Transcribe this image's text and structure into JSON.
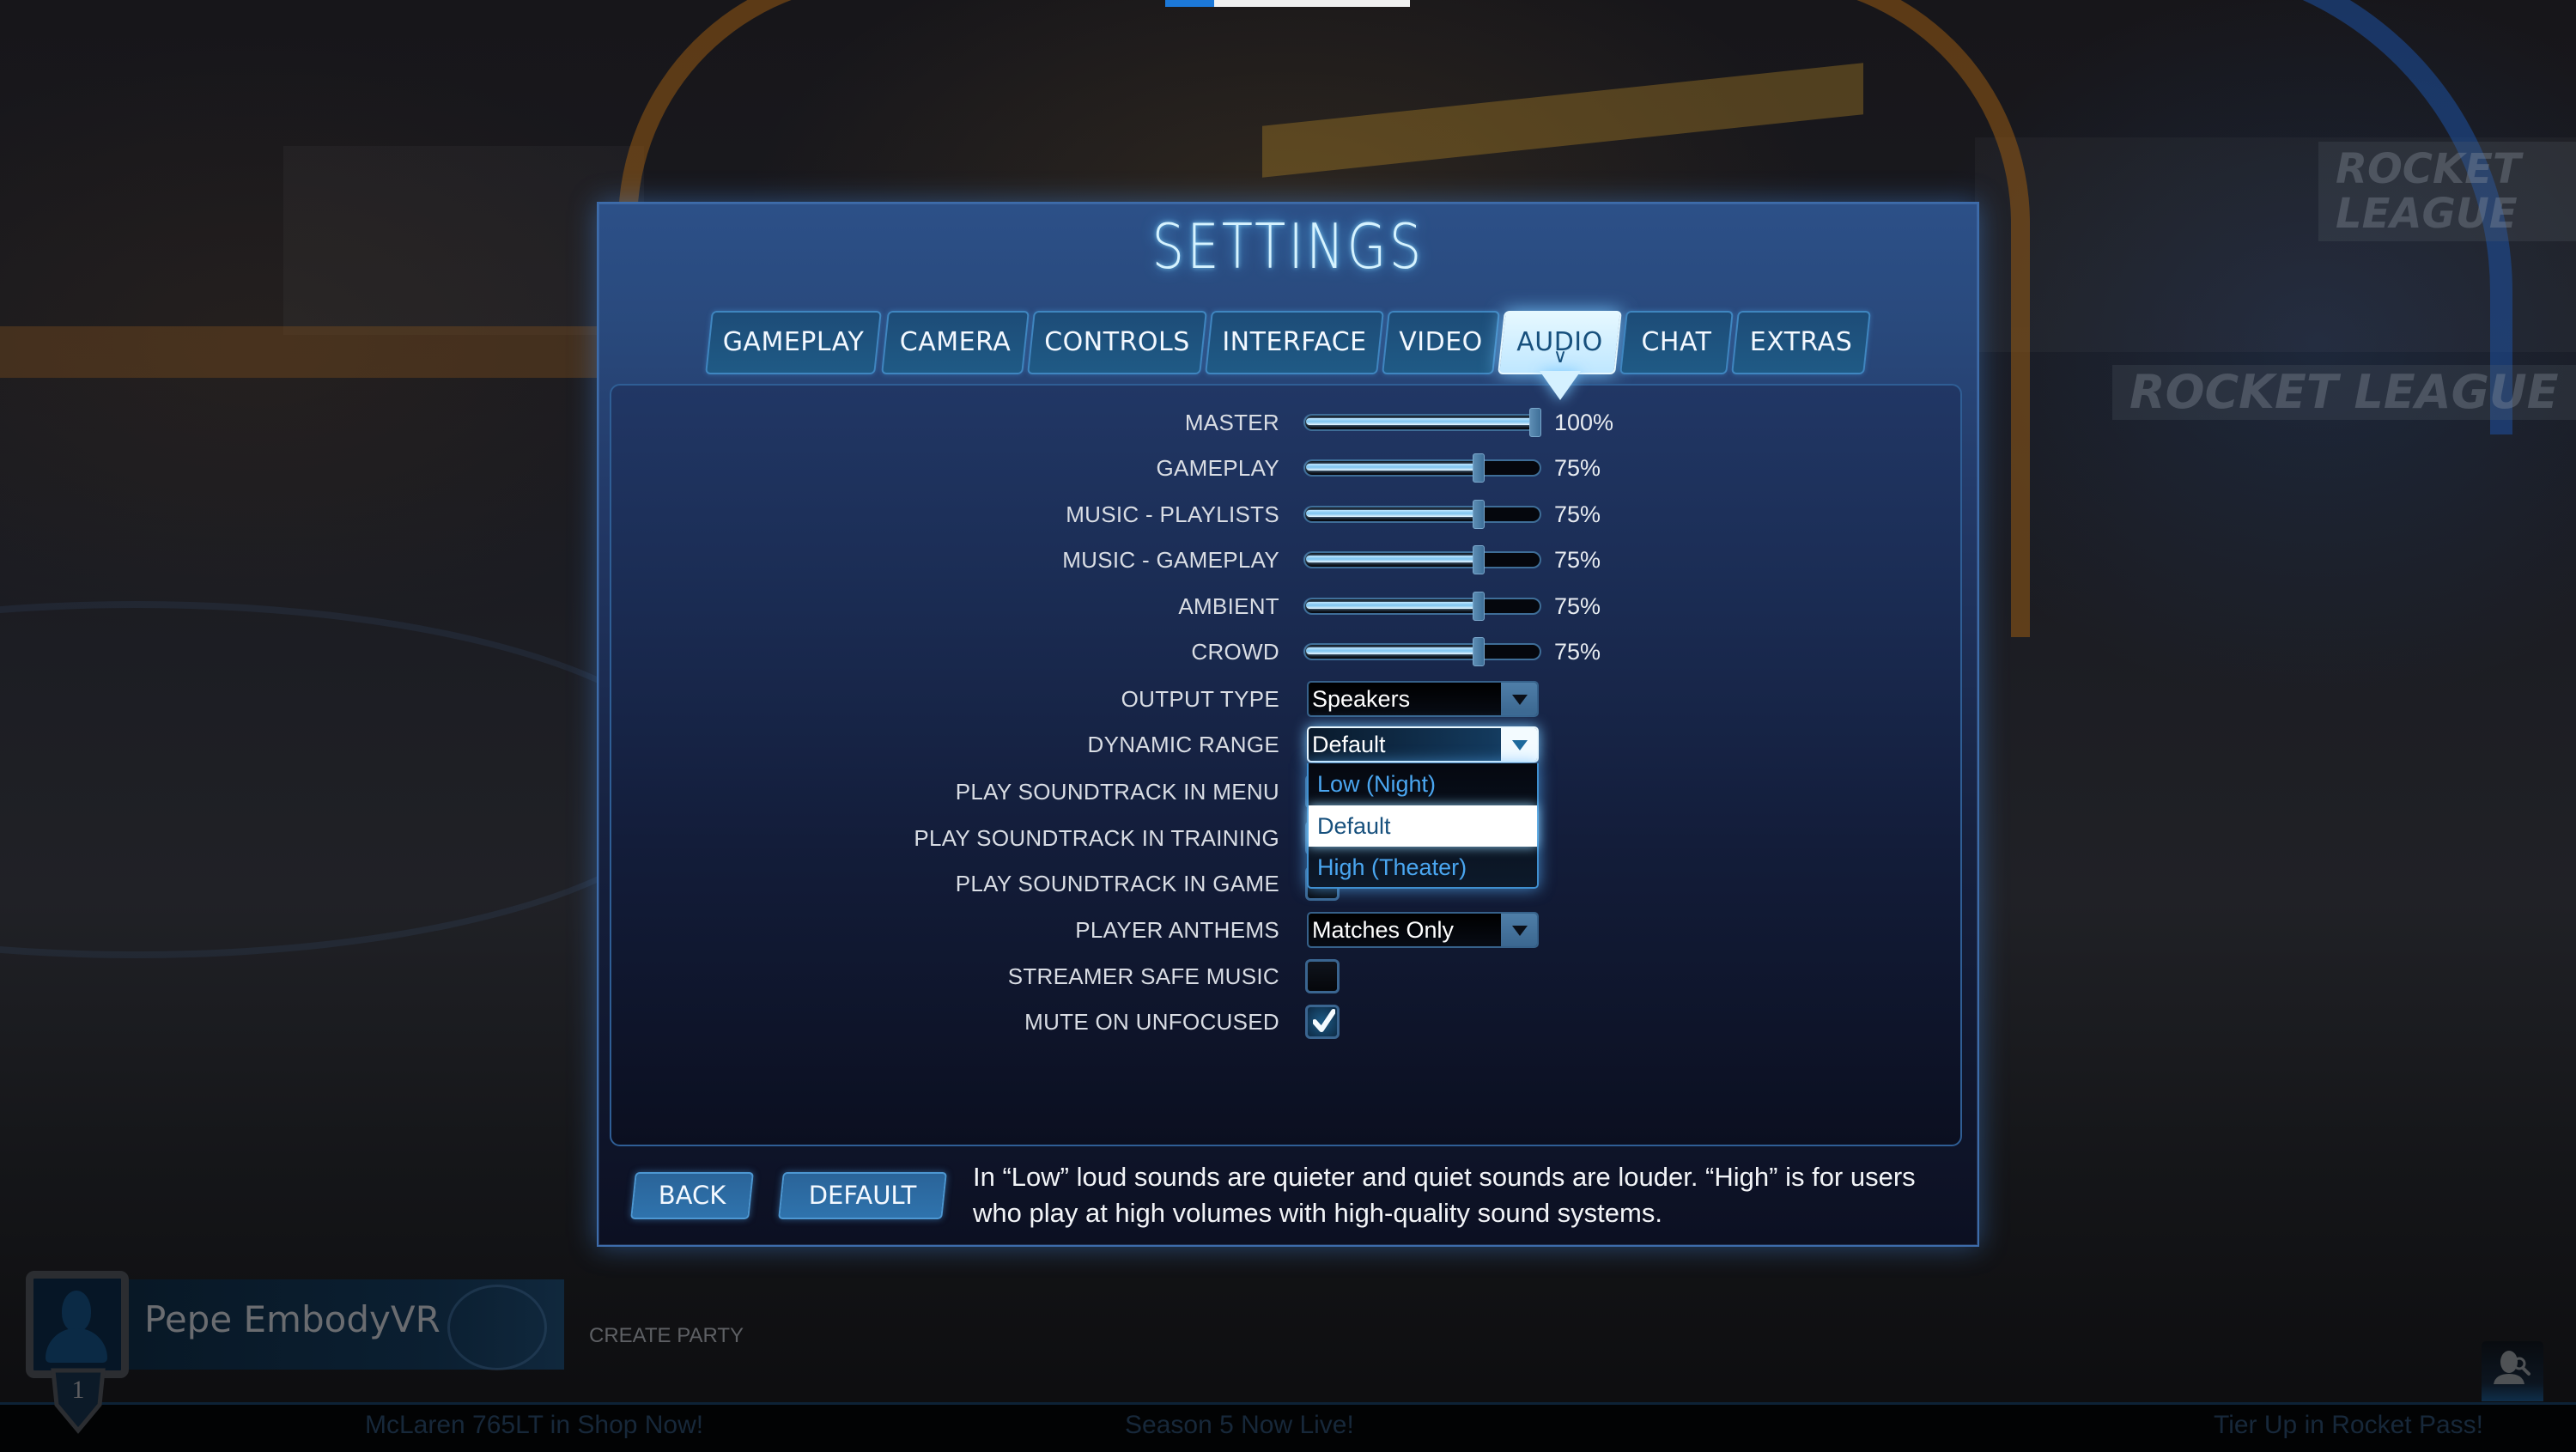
{
  "top_progress": {
    "percent": 20
  },
  "settings": {
    "title": "SETTINGS",
    "tabs": [
      {
        "label": "GAMEPLAY",
        "active": false
      },
      {
        "label": "CAMERA",
        "active": false
      },
      {
        "label": "CONTROLS",
        "active": false
      },
      {
        "label": "INTERFACE",
        "active": false
      },
      {
        "label": "VIDEO",
        "active": false
      },
      {
        "label": "AUDIO",
        "active": true
      },
      {
        "label": "CHAT",
        "active": false
      },
      {
        "label": "EXTRAS",
        "active": false
      }
    ],
    "sliders": [
      {
        "label": "MASTER",
        "value": 100,
        "display": "100%"
      },
      {
        "label": "GAMEPLAY",
        "value": 75,
        "display": "75%"
      },
      {
        "label": "MUSIC - PLAYLISTS",
        "value": 75,
        "display": "75%"
      },
      {
        "label": "MUSIC - GAMEPLAY",
        "value": 75,
        "display": "75%"
      },
      {
        "label": "AMBIENT",
        "value": 75,
        "display": "75%"
      },
      {
        "label": "CROWD",
        "value": 75,
        "display": "75%"
      }
    ],
    "output_type": {
      "label": "OUTPUT TYPE",
      "value": "Speakers"
    },
    "dynamic_range": {
      "label": "DYNAMIC RANGE",
      "value": "Default",
      "open": true,
      "options": [
        "Low (Night)",
        "Default",
        "High (Theater)"
      ],
      "selected_index": 1
    },
    "soundtrack_checkboxes": [
      {
        "label": "PLAY SOUNDTRACK IN MENU"
      },
      {
        "label": "PLAY SOUNDTRACK IN TRAINING"
      },
      {
        "label": "PLAY SOUNDTRACK IN GAME"
      }
    ],
    "player_anthems": {
      "label": "PLAYER ANTHEMS",
      "value": "Matches Only"
    },
    "streamer_safe_music": {
      "label": "STREAMER SAFE MUSIC",
      "checked": false
    },
    "mute_on_unfocused": {
      "label": "MUTE ON UNFOCUSED",
      "checked": true
    },
    "footer": {
      "back_label": "BACK",
      "default_label": "DEFAULT",
      "help_text": "In “Low” loud sounds are quieter and quiet sounds are louder. “High” is for users who play at high volumes with high-quality sound systems."
    }
  },
  "hud": {
    "player_name": "Pepe EmbodyVR",
    "rank": "1",
    "create_party_label": "CREATE PARTY",
    "ticker": [
      "McLaren 765LT in Shop Now!",
      "Season 5 Now Live!",
      "Tier Up in Rocket Pass!"
    ],
    "friends_icon": "friend-search-icon"
  },
  "background": {
    "banners": [
      "ROCKET LEAGUE",
      "ROCKET LEAGUE"
    ]
  },
  "colors": {
    "accent": "#3f86c0",
    "active_tab": "#e6f8ff",
    "dropdown_option": "#4aa6f0"
  }
}
